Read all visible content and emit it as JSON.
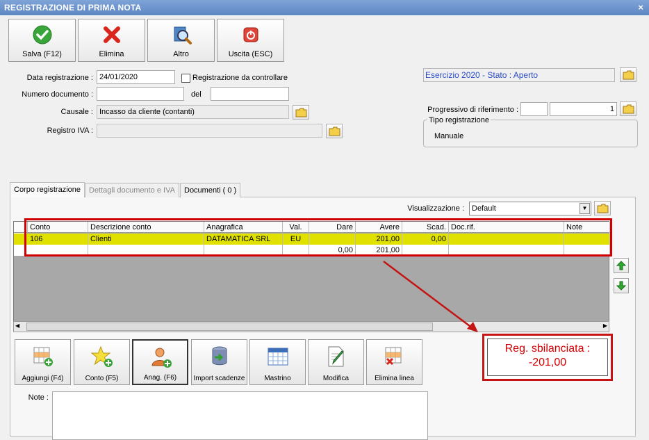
{
  "window": {
    "title": "REGISTRAZIONE DI PRIMA NOTA",
    "close_glyph": "×"
  },
  "toolbar": [
    {
      "label": "Salva (F12)",
      "icon": "check-icon"
    },
    {
      "label": "Elimina",
      "icon": "delete-x-icon"
    },
    {
      "label": "Altro",
      "icon": "magnifier-icon"
    },
    {
      "label": "Uscita (ESC)",
      "icon": "power-icon"
    }
  ],
  "form": {
    "data_label": "Data registrazione :",
    "data_value": "24/01/2020",
    "check_label": "Registrazione da controllare",
    "numero_label": "Numero documento :",
    "numero_value": "",
    "del_label": "del",
    "del_value": "",
    "causale_label": "Causale :",
    "causale_value": "Incasso da cliente (contanti)",
    "registro_label": "Registro IVA :",
    "registro_value": ""
  },
  "right": {
    "esercizio": "Esercizio 2020 - Stato : Aperto",
    "progressivo_label": "Progressivo di riferimento :",
    "progressivo_a": "",
    "progressivo_b": "1",
    "tipo_label": "Tipo registrazione",
    "tipo_value": "Manuale"
  },
  "tabs": [
    {
      "label": "Corpo registrazione",
      "state": "active"
    },
    {
      "label": "Dettagli documento e IVA",
      "state": "disabled"
    },
    {
      "label": "Documenti ( 0 )",
      "state": "normal"
    }
  ],
  "visualizzazione": {
    "label": "Visualizzazione :",
    "value": "Default"
  },
  "grid": {
    "headers": [
      "Conto",
      "Descrizione conto",
      "Anagrafica",
      "Val.",
      "Dare",
      "Avere",
      "Scad.",
      "Doc.rif.",
      "Note"
    ],
    "rows": [
      [
        "106",
        "Clienti",
        "DATAMATICA SRL",
        "EU",
        "",
        "201,00",
        "0,00",
        "",
        ""
      ],
      [
        "",
        "",
        "",
        "",
        "0,00",
        "201,00",
        "",
        "",
        ""
      ]
    ],
    "row_highlight": "#e1e100"
  },
  "alert": {
    "line1": "Reg. sbilanciata :",
    "line2": "-201,00",
    "color": "#d10000"
  },
  "bottom_buttons": [
    {
      "label": "Aggiungi (F4)",
      "icon": "add-row-icon"
    },
    {
      "label": "Conto (F5)",
      "icon": "star-add-icon"
    },
    {
      "label": "Anag. (F6)",
      "icon": "user-add-icon"
    },
    {
      "label": "Import scadenze",
      "icon": "database-import-icon"
    },
    {
      "label": "Mastrino",
      "icon": "calendar-grid-icon"
    },
    {
      "label": "Modifica",
      "icon": "edit-doc-icon"
    },
    {
      "label": "Elimina linea",
      "icon": "delete-row-icon"
    }
  ],
  "note_label": "Note :"
}
